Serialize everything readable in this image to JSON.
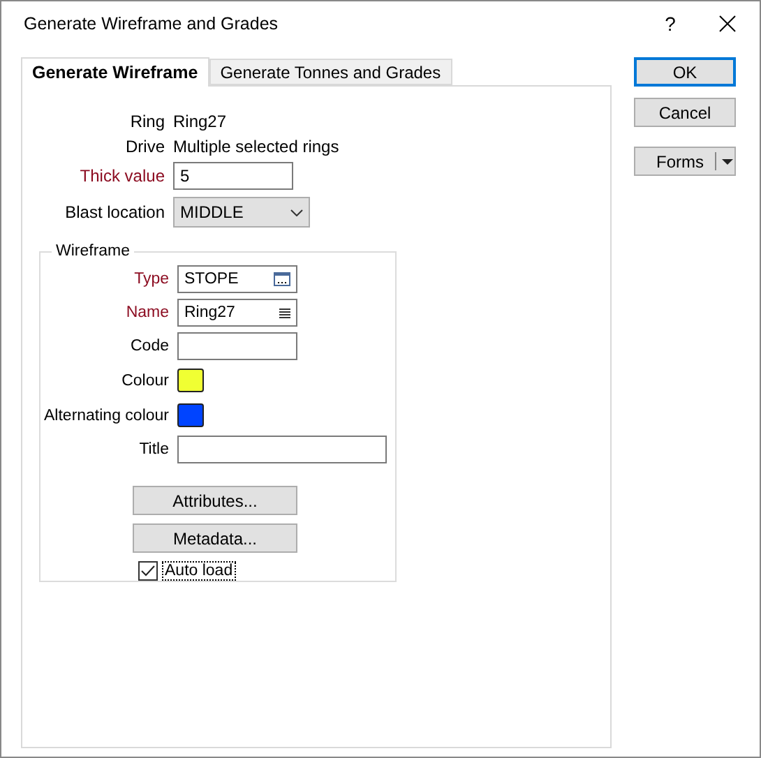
{
  "window": {
    "title": "Generate Wireframe and Grades",
    "help": "?"
  },
  "tabs": [
    {
      "label": "Generate Wireframe",
      "selected": true
    },
    {
      "label": "Generate Tonnes and Grades",
      "selected": false
    }
  ],
  "fields": [
    {
      "kind": "info",
      "label": "Ring",
      "value": "Ring27",
      "required": false
    },
    {
      "kind": "info",
      "label": "Drive",
      "value": "Multiple selected rings",
      "required": false
    },
    {
      "kind": "text",
      "label": "Thick value",
      "value": "5",
      "required": true
    },
    {
      "kind": "combo",
      "label": "Blast location",
      "value": "MIDDLE",
      "required": false
    }
  ],
  "wireframe": {
    "title": "Wireframe",
    "fields": [
      {
        "kind": "browse",
        "label": "Type",
        "value": "STOPE",
        "required": true
      },
      {
        "kind": "list",
        "label": "Name",
        "value": "Ring27",
        "required": true
      },
      {
        "kind": "text",
        "label": "Code",
        "required": false
      },
      {
        "kind": "color",
        "label": "Colour",
        "color": "#f0ff33",
        "required": false
      },
      {
        "kind": "color",
        "label": "Alternating colour",
        "color": "#0044ff",
        "required": false
      },
      {
        "kind": "wide",
        "label": "Title",
        "required": false
      }
    ],
    "buttons": [
      "Attributes...",
      "Metadata..."
    ],
    "auto_load": {
      "label": "Auto load",
      "checked": true
    }
  },
  "buttons": [
    {
      "kind": "ok",
      "label": "OK"
    },
    {
      "kind": "plain",
      "label": "Cancel"
    },
    {
      "kind": "split",
      "label": "Forms"
    }
  ]
}
